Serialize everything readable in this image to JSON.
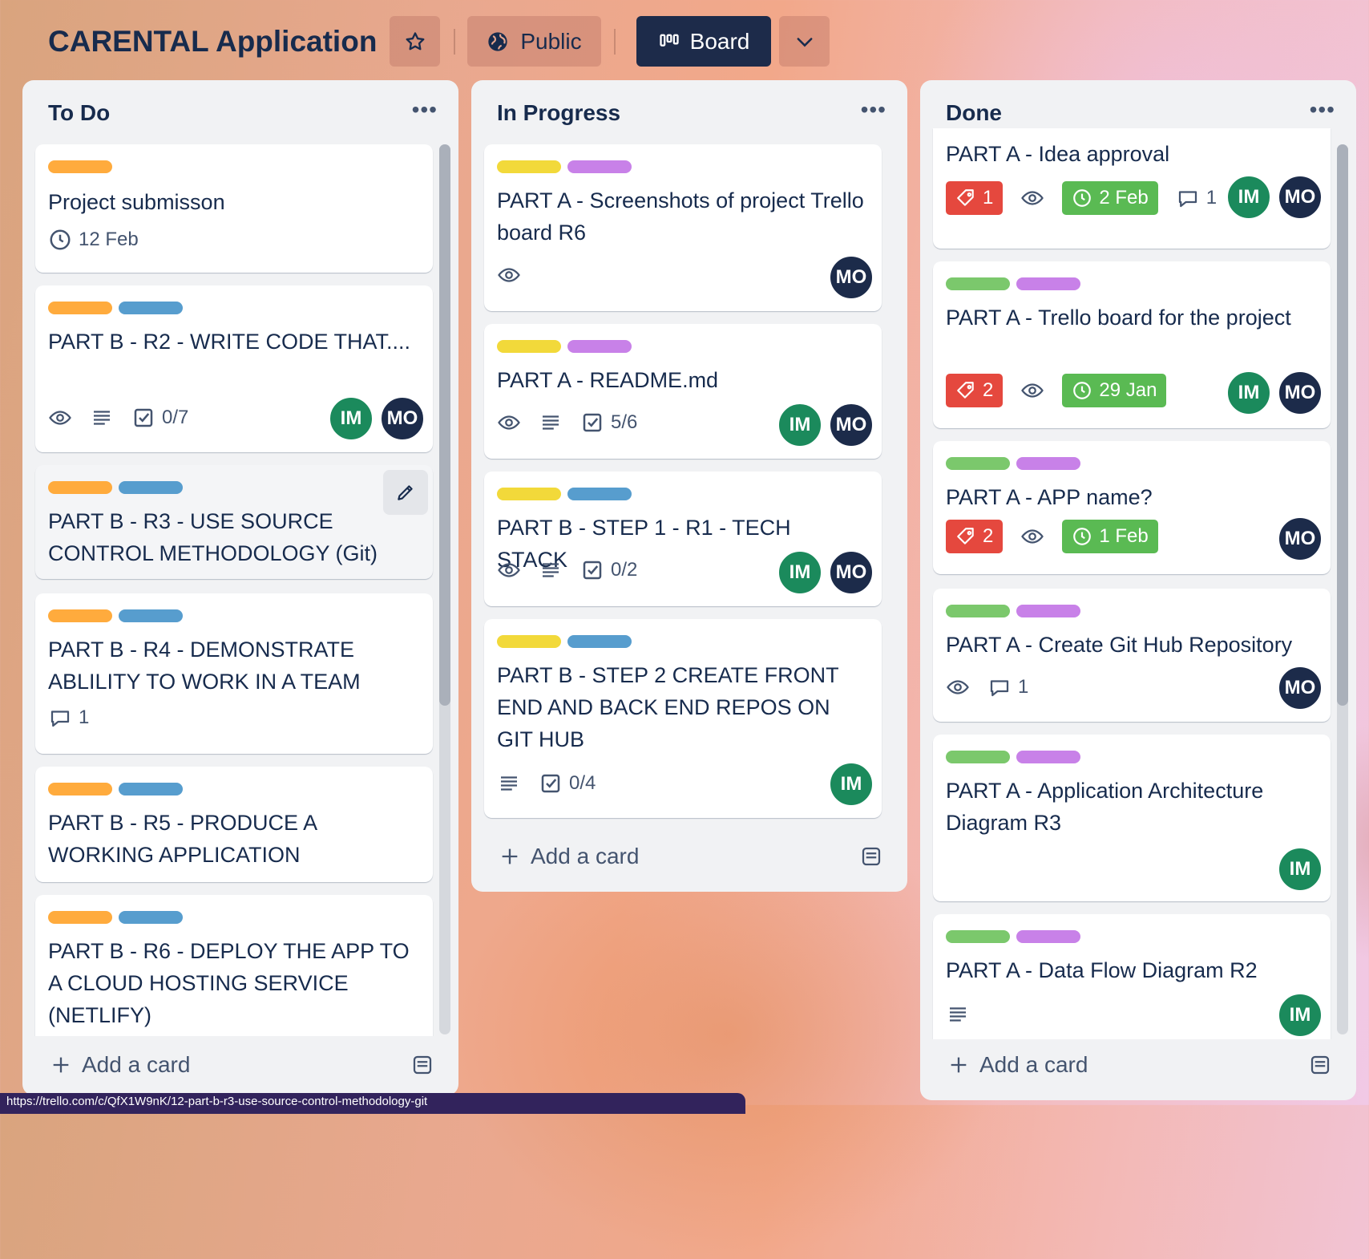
{
  "header": {
    "title": "CARENTAL Application",
    "visibility": "Public",
    "view": "Board",
    "icons": [
      "star-icon",
      "globe-icon",
      "board-icon",
      "chevron-down-icon"
    ]
  },
  "colors": {
    "orange": "#ffab3d",
    "blue": "#579dce",
    "yellow": "#f2d93a",
    "purple": "#c881e8",
    "green": "#7bc86c",
    "red_badge": "#e5483e",
    "green_badge": "#5aba53",
    "avatar_im": "#1b8a5c",
    "avatar_mo": "#1c2b4a"
  },
  "lists": [
    {
      "name": "To Do",
      "add_card": "Add a card",
      "cards": [
        {
          "title": "Project submisson",
          "due": "12 Feb",
          "labels": [
            "orange"
          ]
        },
        {
          "title": "PART B - R2 - WRITE CODE THAT....",
          "checklist": "0/7",
          "labels": [
            "orange",
            "blue"
          ],
          "members": [
            "IM",
            "MO"
          ]
        },
        {
          "title": "PART B - R3 - USE SOURCE CONTROL METHODOLOGY (Git)",
          "labels": [
            "orange",
            "blue"
          ]
        },
        {
          "title": "PART B - R4 - DEMONSTRATE ABLILITY TO WORK IN A TEAM",
          "comments": "1",
          "labels": [
            "orange",
            "blue"
          ]
        },
        {
          "title": "PART B - R5 - PRODUCE A WORKING APPLICATION",
          "labels": [
            "orange",
            "blue"
          ]
        },
        {
          "title": "PART B - R6 - DEPLOY THE APP TO A CLOUD HOSTING SERVICE (NETLIFY)",
          "labels": [
            "orange",
            "blue"
          ]
        }
      ]
    },
    {
      "name": "In Progress",
      "add_card": "Add a card",
      "cards": [
        {
          "title": "PART A - Screenshots of project Trello board R6",
          "labels": [
            "yellow",
            "purple"
          ],
          "members": [
            "MO"
          ]
        },
        {
          "title": "PART A - README.md",
          "checklist": "5/6",
          "labels": [
            "yellow",
            "purple"
          ],
          "members": [
            "IM",
            "MO"
          ]
        },
        {
          "title": "PART B - STEP 1 - R1 - TECH STACK",
          "checklist": "0/2",
          "labels": [
            "yellow",
            "blue"
          ],
          "members": [
            "IM",
            "MO"
          ]
        },
        {
          "title": "PART B - STEP 2 CREATE FRONT END AND BACK END REPOS ON GIT HUB",
          "checklist": "0/4",
          "labels": [
            "yellow",
            "blue"
          ],
          "members": [
            "IM"
          ]
        }
      ]
    },
    {
      "name": "Done",
      "add_card": "Add a card",
      "cards": [
        {
          "title": "PART A - Idea approval",
          "votes": "1",
          "due": "2 Feb",
          "comments": "1",
          "members": [
            "IM",
            "MO"
          ]
        },
        {
          "title": "PART A - Trello board for the project",
          "votes": "2",
          "due": "29 Jan",
          "labels": [
            "green",
            "purple"
          ],
          "members": [
            "IM",
            "MO"
          ]
        },
        {
          "title": "PART A - APP name?",
          "votes": "2",
          "due": "1 Feb",
          "labels": [
            "green",
            "purple"
          ],
          "members": [
            "MO"
          ]
        },
        {
          "title": "PART A - Create Git Hub Repository",
          "comments": "1",
          "labels": [
            "green",
            "purple"
          ],
          "members": [
            "MO"
          ]
        },
        {
          "title": "PART A - Application Architecture Diagram R3",
          "labels": [
            "green",
            "purple"
          ],
          "members": [
            "IM"
          ]
        },
        {
          "title": "PART A - Data Flow Diagram R2",
          "labels": [
            "green",
            "purple"
          ],
          "members": [
            "IM"
          ]
        }
      ]
    }
  ],
  "status_bar": "https://trello.com/c/QfX1W9nK/12-part-b-r3-use-source-control-methodology-git"
}
